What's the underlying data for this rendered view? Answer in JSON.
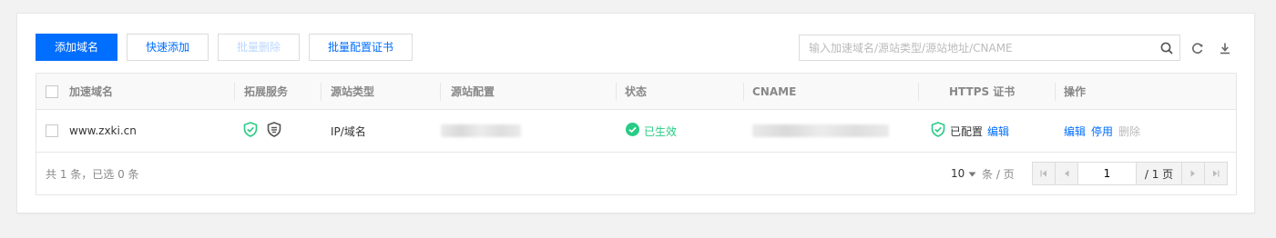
{
  "toolbar": {
    "add_domain": "添加域名",
    "quick_add": "快速添加",
    "batch_delete": "批量删除",
    "batch_cert": "批量配置证书"
  },
  "search": {
    "placeholder": "输入加速域名/源站类型/源站地址/CNAME",
    "icon": "search-icon"
  },
  "tools": {
    "refresh_icon": "refresh-icon",
    "download_icon": "download-icon"
  },
  "table": {
    "columns": [
      "加速域名",
      "拓展服务",
      "源站类型",
      "源站配置",
      "状态",
      "CNAME",
      "HTTPS 证书",
      "操作"
    ],
    "rows": [
      {
        "domain": "www.zxki.cn",
        "services": [
          "shield-check-icon",
          "waf-shield-icon"
        ],
        "origin_type": "IP/域名",
        "status": "已生效",
        "https_status": "已配置",
        "https_edit": "编辑",
        "actions": [
          "编辑",
          "停用",
          "删除"
        ]
      }
    ]
  },
  "footer": {
    "summary": "共 1 条，已选 0 条",
    "page_size": "10",
    "per_page_suffix": "条 / 页",
    "current_page": "1",
    "total_pages": "/ 1 页"
  },
  "colors": {
    "accent": "#006eff",
    "success": "#29cc85",
    "disabled_text": "#bbd7ff"
  }
}
